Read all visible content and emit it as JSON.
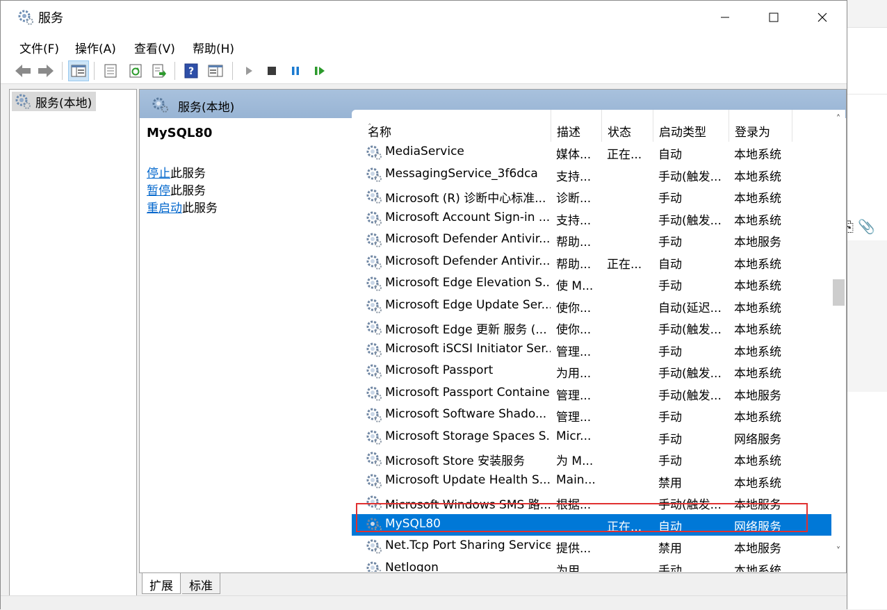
{
  "window": {
    "title": "服务",
    "controls": {
      "minimize": "minimize-icon",
      "maximize": "maximize-icon",
      "close": "close-icon"
    }
  },
  "menu": [
    "文件(F)",
    "操作(A)",
    "查看(V)",
    "帮助(H)"
  ],
  "toolbar": {
    "icons": [
      "back-arrow-icon",
      "forward-arrow-icon",
      "show-hide-console-tree-icon",
      "properties-icon",
      "refresh-icon",
      "export-list-icon",
      "help-icon",
      "show-hide-action-pane-icon",
      "start-service-icon",
      "stop-service-icon",
      "pause-service-icon",
      "restart-service-icon"
    ]
  },
  "tree": {
    "root_label": "服务(本地)"
  },
  "panel": {
    "title": "服务(本地)"
  },
  "description": {
    "service_name": "MySQL80",
    "actions": [
      {
        "link": "停止",
        "suffix": "此服务"
      },
      {
        "link": "暂停",
        "suffix": "此服务"
      },
      {
        "link": "重启动",
        "suffix": "此服务"
      }
    ]
  },
  "columns": [
    "名称",
    "描述",
    "状态",
    "启动类型",
    "登录为"
  ],
  "services": [
    {
      "name": "MediaService",
      "desc": "媒体...",
      "status": "正在...",
      "startup": "自动",
      "logon": "本地系统"
    },
    {
      "name": "MessagingService_3f6dca",
      "desc": "支持...",
      "status": "",
      "startup": "手动(触发...",
      "logon": "本地系统"
    },
    {
      "name": "Microsoft (R) 诊断中心标准...",
      "desc": "诊断...",
      "status": "",
      "startup": "手动",
      "logon": "本地系统"
    },
    {
      "name": "Microsoft Account Sign-in ...",
      "desc": "支持...",
      "status": "",
      "startup": "手动(触发...",
      "logon": "本地系统"
    },
    {
      "name": "Microsoft Defender Antivir...",
      "desc": "帮助...",
      "status": "",
      "startup": "手动",
      "logon": "本地服务"
    },
    {
      "name": "Microsoft Defender Antivir...",
      "desc": "帮助...",
      "status": "正在...",
      "startup": "自动",
      "logon": "本地系统"
    },
    {
      "name": "Microsoft Edge Elevation S...",
      "desc": "使 M...",
      "status": "",
      "startup": "手动",
      "logon": "本地系统"
    },
    {
      "name": "Microsoft Edge Update Ser...",
      "desc": "使你...",
      "status": "",
      "startup": "自动(延迟...",
      "logon": "本地系统"
    },
    {
      "name": "Microsoft Edge 更新 服务 (...",
      "desc": "使你...",
      "status": "",
      "startup": "手动(触发...",
      "logon": "本地系统"
    },
    {
      "name": "Microsoft iSCSI Initiator Ser...",
      "desc": "管理...",
      "status": "",
      "startup": "手动",
      "logon": "本地系统"
    },
    {
      "name": "Microsoft Passport",
      "desc": "为用...",
      "status": "",
      "startup": "手动(触发...",
      "logon": "本地系统"
    },
    {
      "name": "Microsoft Passport Container",
      "desc": "管理...",
      "status": "",
      "startup": "手动(触发...",
      "logon": "本地服务"
    },
    {
      "name": "Microsoft Software Shado...",
      "desc": "管理...",
      "status": "",
      "startup": "手动",
      "logon": "本地系统"
    },
    {
      "name": "Microsoft Storage Spaces S...",
      "desc": "Micr...",
      "status": "",
      "startup": "手动",
      "logon": "网络服务"
    },
    {
      "name": "Microsoft Store 安装服务",
      "desc": "为 M...",
      "status": "",
      "startup": "手动",
      "logon": "本地系统"
    },
    {
      "name": "Microsoft Update Health S...",
      "desc": "Main...",
      "status": "",
      "startup": "禁用",
      "logon": "本地系统"
    },
    {
      "name": "Microsoft Windows SMS 路...",
      "desc": "根据...",
      "status": "",
      "startup": "手动(触发...",
      "logon": "本地服务"
    },
    {
      "name": "MySQL80",
      "desc": "",
      "status": "正在...",
      "startup": "自动",
      "logon": "网络服务",
      "selected": true
    },
    {
      "name": "Net.Tcp Port Sharing Service",
      "desc": "提供...",
      "status": "",
      "startup": "禁用",
      "logon": "本地服务"
    },
    {
      "name": "Netlogon",
      "desc": "为用...",
      "status": "",
      "startup": "手动",
      "logon": "本地系统"
    }
  ],
  "tabs": [
    "扩展",
    "标准"
  ],
  "colors": {
    "accent_selected": "#0078d7",
    "highlight_box": "#e03030",
    "panel_header": "#a8c1dd",
    "link": "#0066cc"
  }
}
